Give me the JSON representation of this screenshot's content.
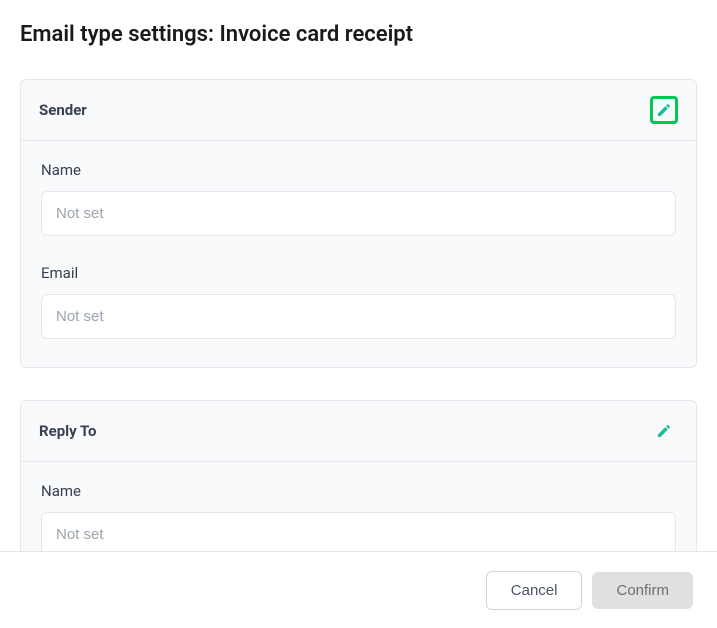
{
  "page": {
    "title": "Email type settings: Invoice card receipt"
  },
  "sections": {
    "sender": {
      "title": "Sender",
      "fields": {
        "name": {
          "label": "Name",
          "placeholder": "Not set",
          "value": ""
        },
        "email": {
          "label": "Email",
          "placeholder": "Not set",
          "value": ""
        }
      }
    },
    "replyTo": {
      "title": "Reply To",
      "fields": {
        "name": {
          "label": "Name",
          "placeholder": "Not set",
          "value": ""
        }
      }
    }
  },
  "footer": {
    "cancel": "Cancel",
    "confirm": "Confirm"
  },
  "icons": {
    "pencil": "pencil-icon"
  }
}
